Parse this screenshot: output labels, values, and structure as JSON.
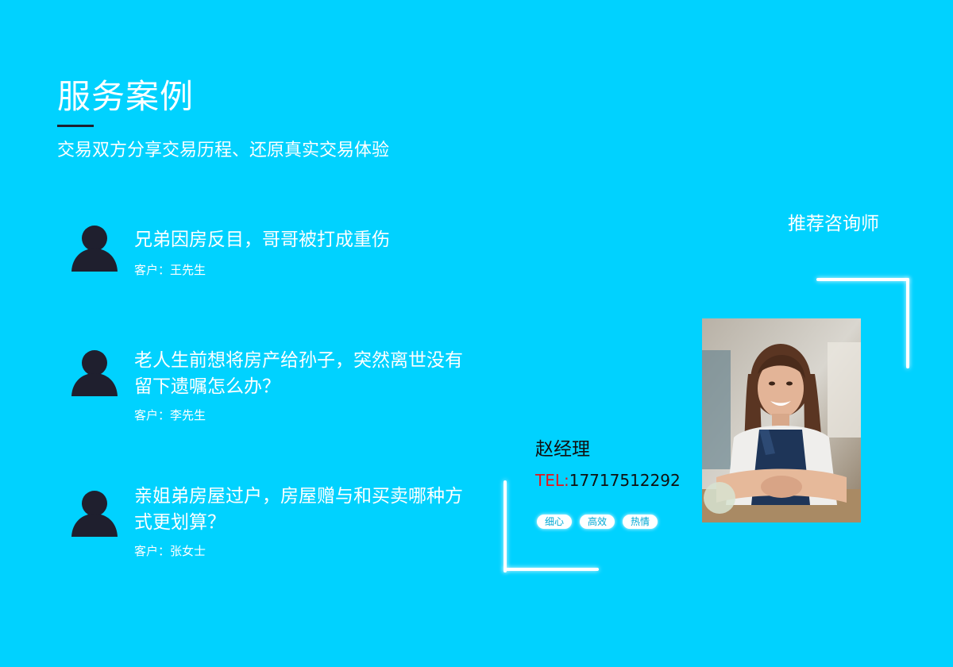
{
  "header": {
    "title": "服务案例",
    "subtitle": "交易双方分享交易历程、还原真实交易体验"
  },
  "cases": [
    {
      "title": "兄弟因房反目，哥哥被打成重伤",
      "client": "客户：王先生"
    },
    {
      "title": "老人生前想将房产给孙子，突然离世没有留下遗嘱怎么办？",
      "client": "客户：李先生"
    },
    {
      "title": "亲姐弟房屋过户，房屋赠与和买卖哪种方式更划算？",
      "client": "客户：张女士"
    }
  ],
  "recommend": {
    "title": "推荐咨询师",
    "name": "赵经理",
    "tel_label": "TEL:",
    "tel_number": "17717512292",
    "tags": [
      "细心",
      "高效",
      "热情"
    ]
  },
  "icons": {
    "client_avatar": "user-silhouette-icon"
  },
  "colors": {
    "background": "#00d2ff",
    "avatar": "#1f1f2e",
    "tel_label": "#e8141a",
    "tag_text": "#00a8d4"
  }
}
